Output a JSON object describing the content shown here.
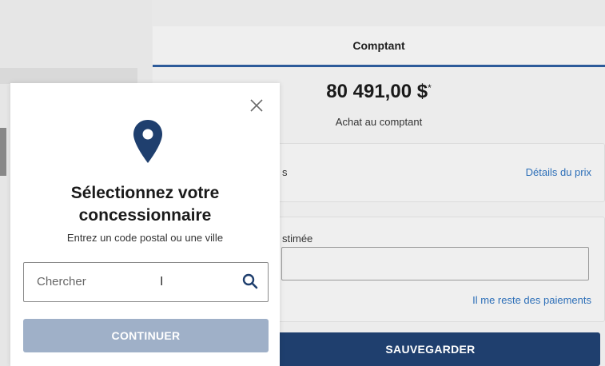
{
  "tab": {
    "label": "Comptant"
  },
  "price": {
    "amount": "80 491,00 $",
    "superscript": "*",
    "label": "Achat au comptant"
  },
  "price_card": {
    "left_fragment": "s",
    "details_link": "Détails du prix"
  },
  "payment_card": {
    "left_fragment": "stimée",
    "link": "Il me reste des paiements"
  },
  "save_button": {
    "label": "SAUVEGARDER"
  },
  "modal": {
    "title_line1": "Sélectionnez votre",
    "title_line2": "concessionnaire",
    "subtitle": "Entrez un code postal ou une ville",
    "search_placeholder": "Chercher",
    "text_cursor": "I",
    "continue_label": "CONTINUER",
    "icons": {
      "close": "close-icon",
      "pin": "location-pin-icon",
      "search": "search-icon"
    }
  },
  "colors": {
    "accent": "#2d5b9a",
    "link": "#2d6fb8",
    "primary_button": "#1f3f6e",
    "disabled_button": "#9fb0c8",
    "pin": "#1f3f6e"
  }
}
